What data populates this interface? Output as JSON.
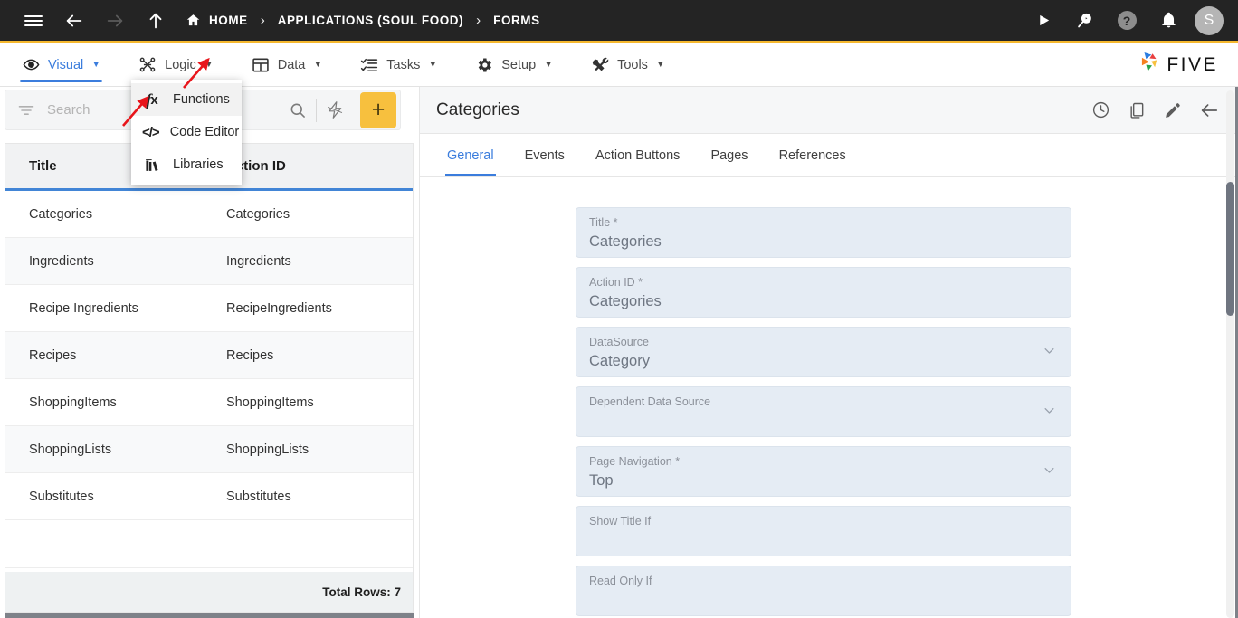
{
  "topbar": {
    "icons": [
      "menu-icon",
      "back-arrow-icon",
      "forward-arrow-icon",
      "up-arrow-icon"
    ],
    "breadcrumb": [
      {
        "label": "HOME",
        "icon": "home-icon"
      },
      {
        "label": "APPLICATIONS (SOUL FOOD)",
        "icon": ""
      },
      {
        "label": "FORMS",
        "icon": ""
      }
    ],
    "separator": "›",
    "right_icons": [
      "play-icon",
      "search-play-icon",
      "help-icon",
      "bell-icon"
    ],
    "help_glyph": "?",
    "avatar_initial": "S",
    "accent_color": "#f5b82e",
    "background_color": "#242424"
  },
  "menubar": {
    "items": [
      {
        "label": "Visual",
        "icon": "eye-icon",
        "caret": "▼",
        "active": true
      },
      {
        "label": "Logic",
        "icon": "logic-nodes-icon",
        "caret": "▼",
        "active": false
      },
      {
        "label": "Data",
        "icon": "table-icon",
        "caret": "▼",
        "active": false
      },
      {
        "label": "Tasks",
        "icon": "tasks-list-icon",
        "caret": "▼",
        "active": false
      },
      {
        "label": "Setup",
        "icon": "gear-icon",
        "caret": "▼",
        "active": false
      },
      {
        "label": "Tools",
        "icon": "tools-icon",
        "caret": "▼",
        "active": false
      }
    ],
    "logo_text": "FIVE",
    "active_color": "#3b7ddd"
  },
  "logic_dropdown": {
    "open": true,
    "items": [
      {
        "label": "Functions",
        "icon": "fx-icon",
        "highlighted": true
      },
      {
        "label": "Code Editor",
        "icon": "code-brackets-icon",
        "highlighted": false
      },
      {
        "label": "Libraries",
        "icon": "books-icon",
        "highlighted": false
      }
    ]
  },
  "left_panel": {
    "search": {
      "value": "",
      "placeholder": "Search"
    },
    "toolbar_icons": [
      "filter-icon",
      "search-icon",
      "lightning-icon"
    ],
    "add_button_glyph": "+",
    "add_button_color": "#f7c03e",
    "grid": {
      "columns": [
        "Title",
        "Action ID"
      ],
      "rows": [
        {
          "title": "Categories",
          "action_id": "Categories"
        },
        {
          "title": "Ingredients",
          "action_id": "Ingredients"
        },
        {
          "title": "Recipe Ingredients",
          "action_id": "RecipeIngredients"
        },
        {
          "title": "Recipes",
          "action_id": "Recipes"
        },
        {
          "title": "ShoppingItems",
          "action_id": "ShoppingItems"
        },
        {
          "title": "ShoppingLists",
          "action_id": "ShoppingLists"
        },
        {
          "title": "Substitutes",
          "action_id": "Substitutes"
        }
      ],
      "footer": "Total Rows: 7",
      "header_underline_color": "#4285d6"
    }
  },
  "right_panel": {
    "title": "Categories",
    "header_actions": [
      "history-clock-icon",
      "copy-icon",
      "edit-pencil-icon",
      "back-arrow-icon"
    ],
    "tabs": [
      {
        "label": "General",
        "active": true
      },
      {
        "label": "Events",
        "active": false
      },
      {
        "label": "Action Buttons",
        "active": false
      },
      {
        "label": "Pages",
        "active": false
      },
      {
        "label": "References",
        "active": false
      }
    ],
    "fields": [
      {
        "label": "Title *",
        "value": "Categories",
        "type": "text",
        "caret": ""
      },
      {
        "label": "Action ID *",
        "value": "Categories",
        "type": "text",
        "caret": ""
      },
      {
        "label": "DataSource",
        "value": "Category",
        "type": "select",
        "caret": "⌄"
      },
      {
        "label": "Dependent Data Source",
        "value": "",
        "type": "select",
        "caret": "⌄"
      },
      {
        "label": "Page Navigation *",
        "value": "Top",
        "type": "select",
        "caret": "⌄"
      },
      {
        "label": "Show Title If",
        "value": "",
        "type": "text",
        "caret": ""
      },
      {
        "label": "Read Only If",
        "value": "",
        "type": "text",
        "caret": ""
      }
    ]
  },
  "annotations": {
    "arrows": [
      {
        "name": "arrow-to-logic-caret",
        "color": "#e8151b"
      },
      {
        "name": "arrow-to-functions-item",
        "color": "#e8151b"
      }
    ]
  }
}
